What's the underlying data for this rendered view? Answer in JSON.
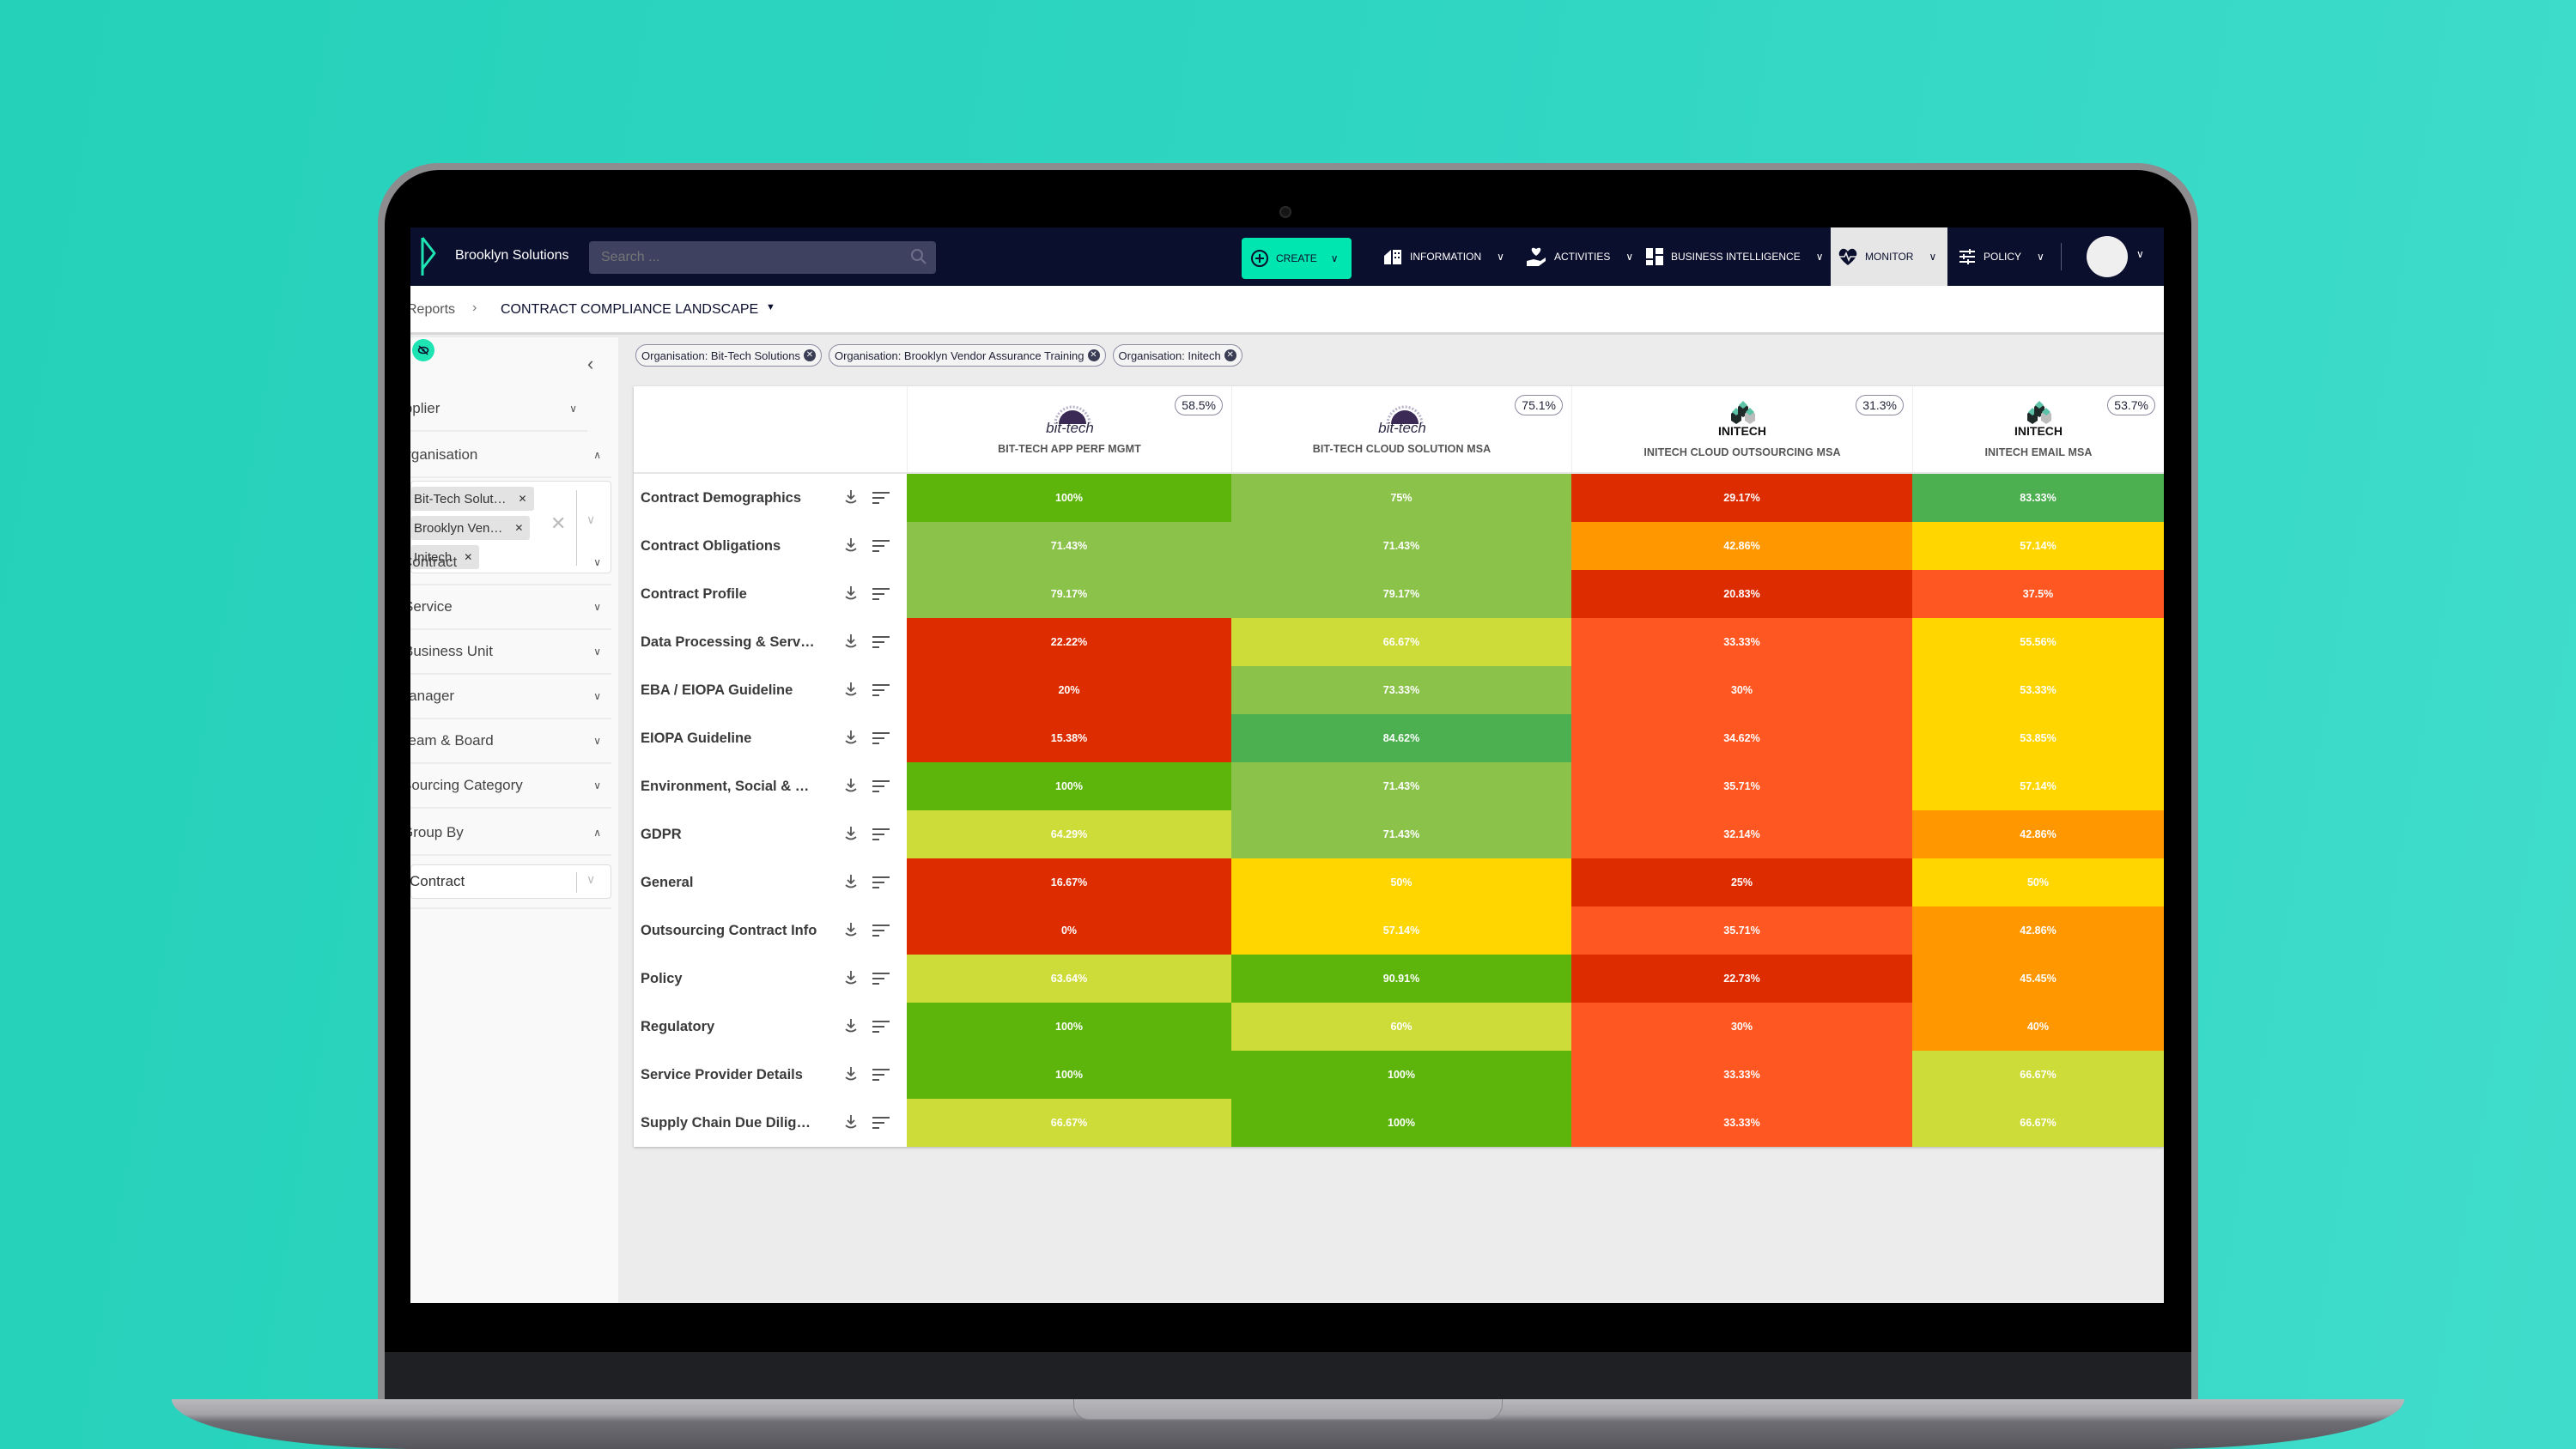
{
  "navbar": {
    "brand": "Brooklyn Solutions",
    "search_placeholder": "Search ...",
    "create_label": "CREATE",
    "items": [
      {
        "label": "INFORMATION",
        "icon": "building-icon"
      },
      {
        "label": "ACTIVITIES",
        "icon": "hand-heart-icon"
      },
      {
        "label": "BUSINESS INTELLIGENCE",
        "icon": "dashboard-icon"
      },
      {
        "label": "MONITOR",
        "icon": "heartbeat-icon",
        "active": true
      },
      {
        "label": "POLICY",
        "icon": "sliders-icon"
      }
    ],
    "accent": "#00e6b0",
    "background": "#0b0f2e"
  },
  "breadcrumb": {
    "parent": "Reports",
    "separator": "›",
    "current": "CONTRACT COMPLIANCE LANDSCAPE"
  },
  "sidebar": {
    "filters": [
      {
        "label": "Supplier",
        "expanded": false
      },
      {
        "label": "Organisation",
        "expanded": true
      },
      {
        "label": "Contract",
        "expanded": false
      },
      {
        "label": "Service",
        "expanded": false
      },
      {
        "label": "Business Unit",
        "expanded": false
      },
      {
        "label": "Manager",
        "expanded": false
      },
      {
        "label": "Team & Board",
        "expanded": false
      },
      {
        "label": "Sourcing Category",
        "expanded": false
      },
      {
        "label": "Group By",
        "expanded": true
      }
    ],
    "organisation_tags": [
      "Bit-Tech Solut…",
      "Brooklyn Ven…",
      "Initech"
    ],
    "group_by_value": "Contract"
  },
  "active_filters": [
    "Organisation: Bit-Tech Solutions",
    "Organisation: Brooklyn Vendor Assurance Training",
    "Organisation: Initech"
  ],
  "chart_data": {
    "type": "heatmap",
    "title": "CONTRACT COMPLIANCE LANDSCAPE",
    "columns": [
      {
        "name": "BIT-TECH APP PERF MGMT",
        "supplier": "bit-tech",
        "overall": "58.5%"
      },
      {
        "name": "BIT-TECH CLOUD SOLUTION MSA",
        "supplier": "bit-tech",
        "overall": "75.1%"
      },
      {
        "name": "INITECH CLOUD OUTSOURCING MSA",
        "supplier": "INITECH",
        "overall": "31.3%"
      },
      {
        "name": "INITECH EMAIL MSA",
        "supplier": "INITECH",
        "overall": "53.7%"
      }
    ],
    "rows": [
      "Contract Demographics",
      "Contract Obligations",
      "Contract Profile",
      "Data Processing & Serv…",
      "EBA / EIOPA Guideline",
      "EIOPA Guideline",
      "Environment, Social & …",
      "GDPR",
      "General",
      "Outsourcing Contract Info",
      "Policy",
      "Regulatory",
      "Service Provider Details",
      "Supply Chain Due Dilig…"
    ],
    "values": [
      [
        100,
        75,
        29.17,
        83.33
      ],
      [
        71.43,
        71.43,
        42.86,
        57.14
      ],
      [
        79.17,
        79.17,
        20.83,
        37.5
      ],
      [
        22.22,
        66.67,
        33.33,
        55.56
      ],
      [
        20,
        73.33,
        30,
        53.33
      ],
      [
        15.38,
        84.62,
        34.62,
        53.85
      ],
      [
        100,
        71.43,
        35.71,
        57.14
      ],
      [
        64.29,
        71.43,
        32.14,
        42.86
      ],
      [
        16.67,
        50,
        25,
        50
      ],
      [
        0,
        57.14,
        35.71,
        42.86
      ],
      [
        63.64,
        90.91,
        22.73,
        45.45
      ],
      [
        100,
        60,
        30,
        40
      ],
      [
        100,
        100,
        33.33,
        66.67
      ],
      [
        66.67,
        100,
        33.33,
        66.67
      ]
    ],
    "value_format": "percent",
    "color_scale": [
      {
        "max": 30,
        "color": "#dd2c00"
      },
      {
        "max": 40,
        "color": "#ff5722"
      },
      {
        "max": 50,
        "color": "#ff9800"
      },
      {
        "max": 60,
        "color": "#ffd600"
      },
      {
        "max": 70,
        "color": "#cddc39"
      },
      {
        "max": 80,
        "color": "#8bc34a"
      },
      {
        "max": 90,
        "color": "#4caf50"
      },
      {
        "max": 100,
        "color": "#5db50c"
      }
    ]
  }
}
